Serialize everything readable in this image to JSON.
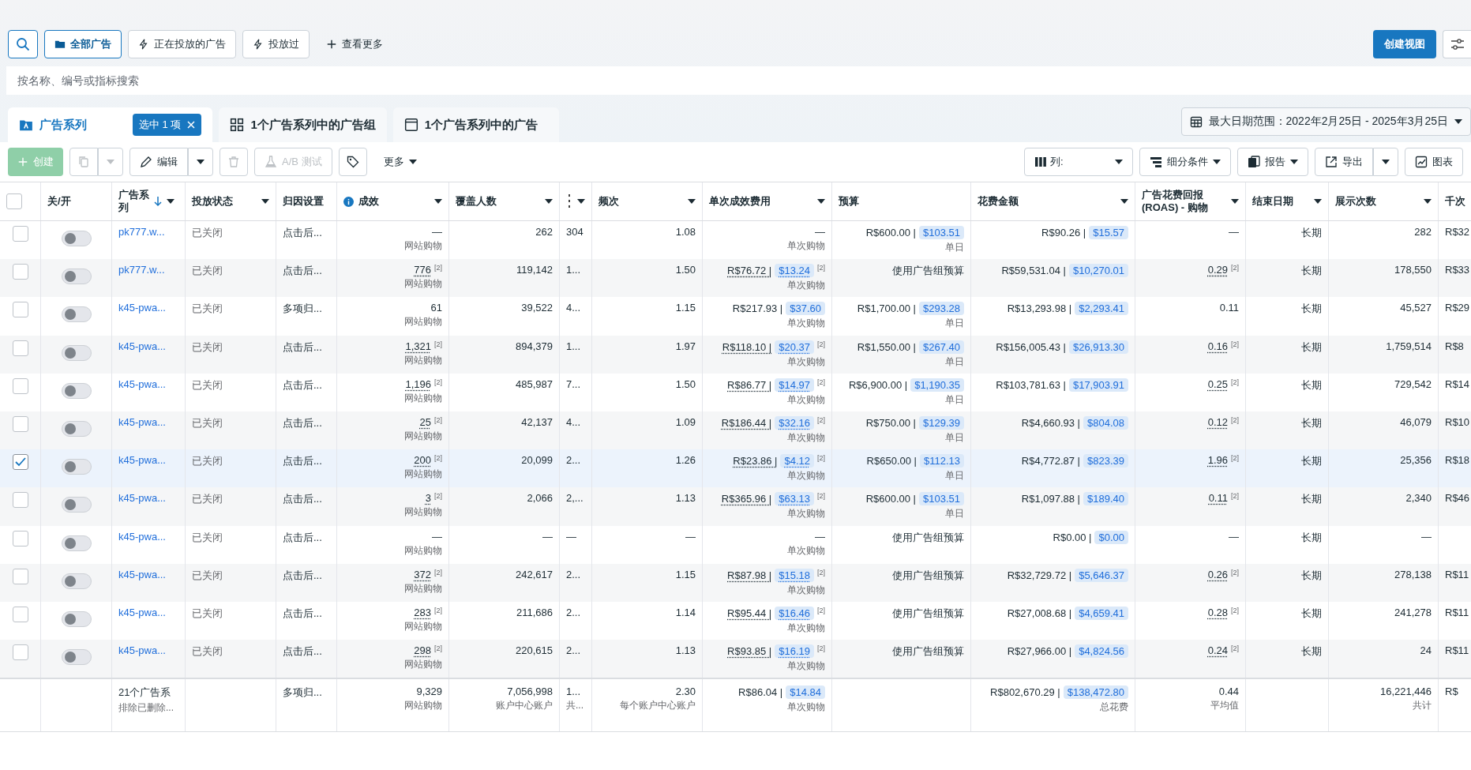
{
  "view_bar": {
    "buttons": [
      {
        "label": "全部广告",
        "kind": "outline",
        "selected": true
      },
      {
        "label": "正在投放的广告",
        "kind": "outline",
        "selected": false
      },
      {
        "label": "投放过",
        "kind": "outline",
        "selected": false
      },
      {
        "label": "查看更多",
        "kind": "plain",
        "selected": false
      }
    ],
    "create_view": "创建视图"
  },
  "search": {
    "placeholder": "按名称、编号或指标搜索"
  },
  "tabs": [
    {
      "label": "广告系列",
      "selected": true,
      "badge": "选中 1 项"
    },
    {
      "label": "1个广告系列中的广告组",
      "selected": false
    },
    {
      "label": "1个广告系列中的广告",
      "selected": false
    }
  ],
  "date_range": "最大日期范围：2022年2月25日 - 2025年3月25日",
  "actions": [
    {
      "label": "创建",
      "kind": "primary",
      "disabled": true
    },
    {
      "kind": "split",
      "disabled": true
    },
    {
      "label": "编辑",
      "kind": "split",
      "disabled": false
    },
    {
      "kind": "button",
      "disabled": true
    },
    {
      "label": "A/B 测试",
      "kind": "button",
      "disabled": true
    },
    {
      "kind": "button",
      "disabled": false
    },
    {
      "label": "更多",
      "kind": "menu",
      "disabled": false
    }
  ],
  "view_actions": [
    {
      "label": "列:",
      "kind": "wide"
    },
    {
      "label": "细分条件",
      "kind": "menu"
    },
    {
      "label": "报告",
      "kind": "menu"
    },
    {
      "label": "导出",
      "kind": "split"
    },
    {
      "label": "图表",
      "kind": "button"
    }
  ],
  "select_all": {
    "checked": false
  },
  "columns": [
    {
      "label": "关/开",
      "kind": "toggle",
      "menu": false,
      "sorted": false,
      "info": false
    },
    {
      "label": "广告系列",
      "kind": "link",
      "menu": true,
      "sorted": true,
      "info": false
    },
    {
      "label": "投放状态",
      "kind": "muted",
      "menu": true,
      "sorted": false,
      "info": false
    },
    {
      "label": "归因设置",
      "kind": "text",
      "menu": false,
      "sorted": false,
      "info": false
    },
    {
      "label": "成效",
      "kind": "number",
      "menu": true,
      "sorted": false,
      "info": true
    },
    {
      "label": "覆盖人数",
      "kind": "number",
      "menu": true,
      "sorted": false,
      "info": false
    },
    {
      "kind": "short",
      "menu": true,
      "sorted": false,
      "info": false
    },
    {
      "label": "频次",
      "kind": "number",
      "menu": true,
      "sorted": false,
      "info": false
    },
    {
      "label": "单次成效费用",
      "kind": "number",
      "menu": true,
      "sorted": false,
      "info": false
    },
    {
      "label": "预算",
      "kind": "number",
      "menu": false,
      "sorted": false,
      "info": false
    },
    {
      "label": "花费金额",
      "kind": "number",
      "menu": true,
      "sorted": false,
      "info": false
    },
    {
      "label": "广告花费回报 (ROAS) - 购物",
      "kind": "number",
      "menu": true,
      "sorted": false,
      "info": false
    },
    {
      "label": "结束日期",
      "kind": "number",
      "menu": true,
      "sorted": false,
      "info": false
    },
    {
      "label": "展示次数",
      "kind": "number",
      "menu": true,
      "sorted": false,
      "info": false
    },
    {
      "label": "千次",
      "kind": "short",
      "menu": false,
      "sorted": false,
      "info": false
    }
  ],
  "rows": [
    {
      "selected": false,
      "on": false,
      "cells": [
        "pk777.w...",
        "已关闭",
        "点击后...",
        {
          "text": "—",
          "sub": "网站购物"
        },
        "262",
        "304",
        "1.08",
        {
          "text": "—",
          "sub": "单次购物"
        },
        {
          "text": "R$600.00 |",
          "usd": "$103.51",
          "sub": "单日"
        },
        {
          "text": "R$90.26 |",
          "usd": "$15.57"
        },
        "—",
        "长期",
        "282",
        "R$32"
      ]
    },
    {
      "selected": false,
      "on": false,
      "cells": [
        "pk777.w...",
        "已关闭",
        "点击后...",
        {
          "text": "776",
          "note": "[2]",
          "sub": "网站购物"
        },
        "119,142",
        "1...",
        "1.50",
        {
          "text": "R$76.72 |",
          "usd": "$13.24",
          "note": "[2]",
          "sub": "单次购物"
        },
        "使用广告组预算",
        {
          "text": "R$59,531.04 |",
          "usd": "$10,270.01"
        },
        {
          "text": "0.29",
          "note": "[2]"
        },
        "长期",
        "178,550",
        "R$33"
      ]
    },
    {
      "selected": false,
      "on": false,
      "cells": [
        "k45-pwa...",
        "已关闭",
        "多项归...",
        {
          "text": "61",
          "sub": "网站购物"
        },
        "39,522",
        "4...",
        "1.15",
        {
          "text": "R$217.93 |",
          "usd": "$37.60",
          "sub": "单次购物"
        },
        {
          "text": "R$1,700.00 |",
          "usd": "$293.28",
          "sub": "单日"
        },
        {
          "text": "R$13,293.98 |",
          "usd": "$2,293.41"
        },
        "0.11",
        "长期",
        "45,527",
        "R$29"
      ]
    },
    {
      "selected": false,
      "on": false,
      "cells": [
        "k45-pwa...",
        "已关闭",
        "点击后...",
        {
          "text": "1,321",
          "note": "[2]",
          "sub": "网站购物"
        },
        "894,379",
        "1...",
        "1.97",
        {
          "text": "R$118.10 |",
          "usd": "$20.37",
          "note": "[2]",
          "sub": "单次购物"
        },
        {
          "text": "R$1,550.00 |",
          "usd": "$267.40",
          "sub": "单日"
        },
        {
          "text": "R$156,005.43 |",
          "usd": "$26,913.30"
        },
        {
          "text": "0.16",
          "note": "[2]"
        },
        "长期",
        "1,759,514",
        "R$8"
      ]
    },
    {
      "selected": false,
      "on": false,
      "cells": [
        "k45-pwa...",
        "已关闭",
        "点击后...",
        {
          "text": "1,196",
          "note": "[2]",
          "sub": "网站购物"
        },
        "485,987",
        "7...",
        "1.50",
        {
          "text": "R$86.77 |",
          "usd": "$14.97",
          "note": "[2]",
          "sub": "单次购物"
        },
        {
          "text": "R$6,900.00 |",
          "usd": "$1,190.35",
          "sub": "单日"
        },
        {
          "text": "R$103,781.63 |",
          "usd": "$17,903.91"
        },
        {
          "text": "0.25",
          "note": "[2]"
        },
        "长期",
        "729,542",
        "R$14"
      ]
    },
    {
      "selected": false,
      "on": false,
      "cells": [
        "k45-pwa...",
        "已关闭",
        "点击后...",
        {
          "text": "25",
          "note": "[2]",
          "sub": "网站购物"
        },
        "42,137",
        "4...",
        "1.09",
        {
          "text": "R$186.44 |",
          "usd": "$32.16",
          "note": "[2]",
          "sub": "单次购物"
        },
        {
          "text": "R$750.00 |",
          "usd": "$129.39",
          "sub": "单日"
        },
        {
          "text": "R$4,660.93 |",
          "usd": "$804.08"
        },
        {
          "text": "0.12",
          "note": "[2]"
        },
        "长期",
        "46,079",
        "R$10"
      ]
    },
    {
      "selected": true,
      "on": false,
      "cells": [
        "k45-pwa...",
        "已关闭",
        "点击后...",
        {
          "text": "200",
          "note": "[2]",
          "sub": "网站购物"
        },
        "20,099",
        "2...",
        "1.26",
        {
          "text": "R$23.86 |",
          "usd": "$4.12",
          "note": "[2]",
          "sub": "单次购物"
        },
        {
          "text": "R$650.00 |",
          "usd": "$112.13",
          "sub": "单日"
        },
        {
          "text": "R$4,772.87 |",
          "usd": "$823.39"
        },
        {
          "text": "1.96",
          "note": "[2]"
        },
        "长期",
        "25,356",
        "R$18"
      ]
    },
    {
      "selected": false,
      "on": false,
      "cells": [
        "k45-pwa...",
        "已关闭",
        "点击后...",
        {
          "text": "3",
          "note": "[2]",
          "sub": "网站购物"
        },
        "2,066",
        "2,...",
        "1.13",
        {
          "text": "R$365.96 |",
          "usd": "$63.13",
          "note": "[2]",
          "sub": "单次购物"
        },
        {
          "text": "R$600.00 |",
          "usd": "$103.51",
          "sub": "单日"
        },
        {
          "text": "R$1,097.88 |",
          "usd": "$189.40"
        },
        {
          "text": "0.11",
          "note": "[2]"
        },
        "长期",
        "2,340",
        "R$46"
      ]
    },
    {
      "selected": false,
      "on": false,
      "cells": [
        "k45-pwa...",
        "已关闭",
        "点击后...",
        {
          "text": "—",
          "sub": "网站购物"
        },
        "—",
        "—",
        "—",
        {
          "text": "—",
          "sub": "单次购物"
        },
        "使用广告组预算",
        {
          "text": "R$0.00 |",
          "usd": "$0.00"
        },
        "—",
        "长期",
        "—"
      ]
    },
    {
      "selected": false,
      "on": false,
      "cells": [
        "k45-pwa...",
        "已关闭",
        "点击后...",
        {
          "text": "372",
          "note": "[2]",
          "sub": "网站购物"
        },
        "242,617",
        "2...",
        "1.15",
        {
          "text": "R$87.98 |",
          "usd": "$15.18",
          "note": "[2]",
          "sub": "单次购物"
        },
        "使用广告组预算",
        {
          "text": "R$32,729.72 |",
          "usd": "$5,646.37"
        },
        {
          "text": "0.26",
          "note": "[2]"
        },
        "长期",
        "278,138",
        "R$11"
      ]
    },
    {
      "selected": false,
      "on": false,
      "cells": [
        "k45-pwa...",
        "已关闭",
        "点击后...",
        {
          "text": "283",
          "note": "[2]",
          "sub": "网站购物"
        },
        "211,686",
        "2...",
        "1.14",
        {
          "text": "R$95.44 |",
          "usd": "$16.46",
          "note": "[2]",
          "sub": "单次购物"
        },
        "使用广告组预算",
        {
          "text": "R$27,008.68 |",
          "usd": "$4,659.41"
        },
        {
          "text": "0.28",
          "note": "[2]"
        },
        "长期",
        "241,278",
        "R$11"
      ]
    },
    {
      "selected": false,
      "on": false,
      "cells": [
        "k45-pwa...",
        "已关闭",
        "点击后...",
        {
          "text": "298",
          "note": "[2]",
          "sub": "网站购物"
        },
        "220,615",
        "2...",
        "1.13",
        {
          "text": "R$93.85 |",
          "usd": "$16.19",
          "note": "[2]",
          "sub": "单次购物"
        },
        "使用广告组预算",
        {
          "text": "R$27,966.00 |",
          "usd": "$4,824.56"
        },
        {
          "text": "0.24",
          "note": "[2]"
        },
        "长期",
        "24",
        "R$11"
      ]
    }
  ],
  "totals": {
    "campaign": {
      "text": "21个广告系",
      "sub": "排除已删除..."
    },
    "attribution": "多项归...",
    "results": {
      "text": "9,329",
      "sub": "网站购物"
    },
    "reach": {
      "text": "7,056,998",
      "sub": "账户中心账户"
    },
    "column_7": {
      "text": "1...",
      "sub": "共..."
    },
    "frequency": {
      "text": "2.30",
      "sub": "每个账户中心账户"
    },
    "cost_per_result": {
      "text": "R$86.04 |",
      "usd": "$14.84",
      "sub": "单次购物"
    },
    "amount_spent": {
      "text": "R$802,670.29 |",
      "usd": "$138,472.80",
      "sub": "总花费"
    },
    "roas": {
      "text": "0.44",
      "sub": "平均值"
    },
    "impressions": {
      "text": "16,221,446",
      "sub": "共计"
    },
    "column_15": "R$"
  }
}
